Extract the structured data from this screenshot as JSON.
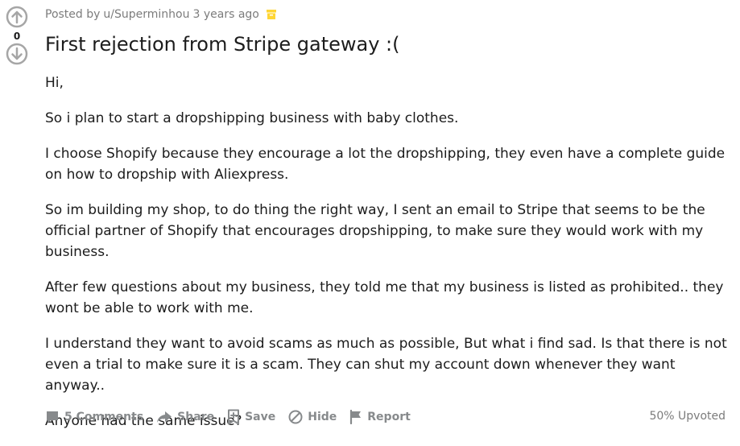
{
  "post": {
    "meta": {
      "prefix": "Posted by",
      "author": "u/Superminhou",
      "time": "3 years ago"
    },
    "score": "0",
    "title": "First rejection from Stripe gateway :(",
    "paragraphs": [
      "Hi,",
      "So i plan to start a dropshipping business with baby clothes.",
      "I choose Shopify because they encourage a lot the dropshipping, they even have a complete guide on how to dropship with Aliexpress.",
      "So im building my shop, to do thing the right way, I sent an email to Stripe that seems to be the official partner of Shopify that encourages dropshipping, to make sure they would work with my business.",
      "After few questions about my business, they told me that my business is listed as prohibited.. they wont be able to work with me.",
      "I understand they want to avoid scams as much as possible, But what i find sad. Is that there is not even a trial to make sure it is a scam. They can shut my account down whenever they want anyway..",
      "Anyone had the same issue?"
    ],
    "actions": {
      "comments": "5 Comments",
      "share": "Share",
      "save": "Save",
      "hide": "Hide",
      "report": "Report"
    },
    "upvoted": "50% Upvoted"
  },
  "icons": {
    "upvote": "arrow-up-circle-icon",
    "downvote": "arrow-down-circle-icon",
    "award": "archive-box-icon",
    "comments": "comment-bubble-icon",
    "share": "share-arrow-icon",
    "save": "bookmark-plus-icon",
    "hide": "hide-circle-icon",
    "report": "flag-icon"
  },
  "colors": {
    "icon_gray": "#a6a6a6",
    "action_gray": "#878a8c",
    "award_yellow": "#ffd635"
  }
}
